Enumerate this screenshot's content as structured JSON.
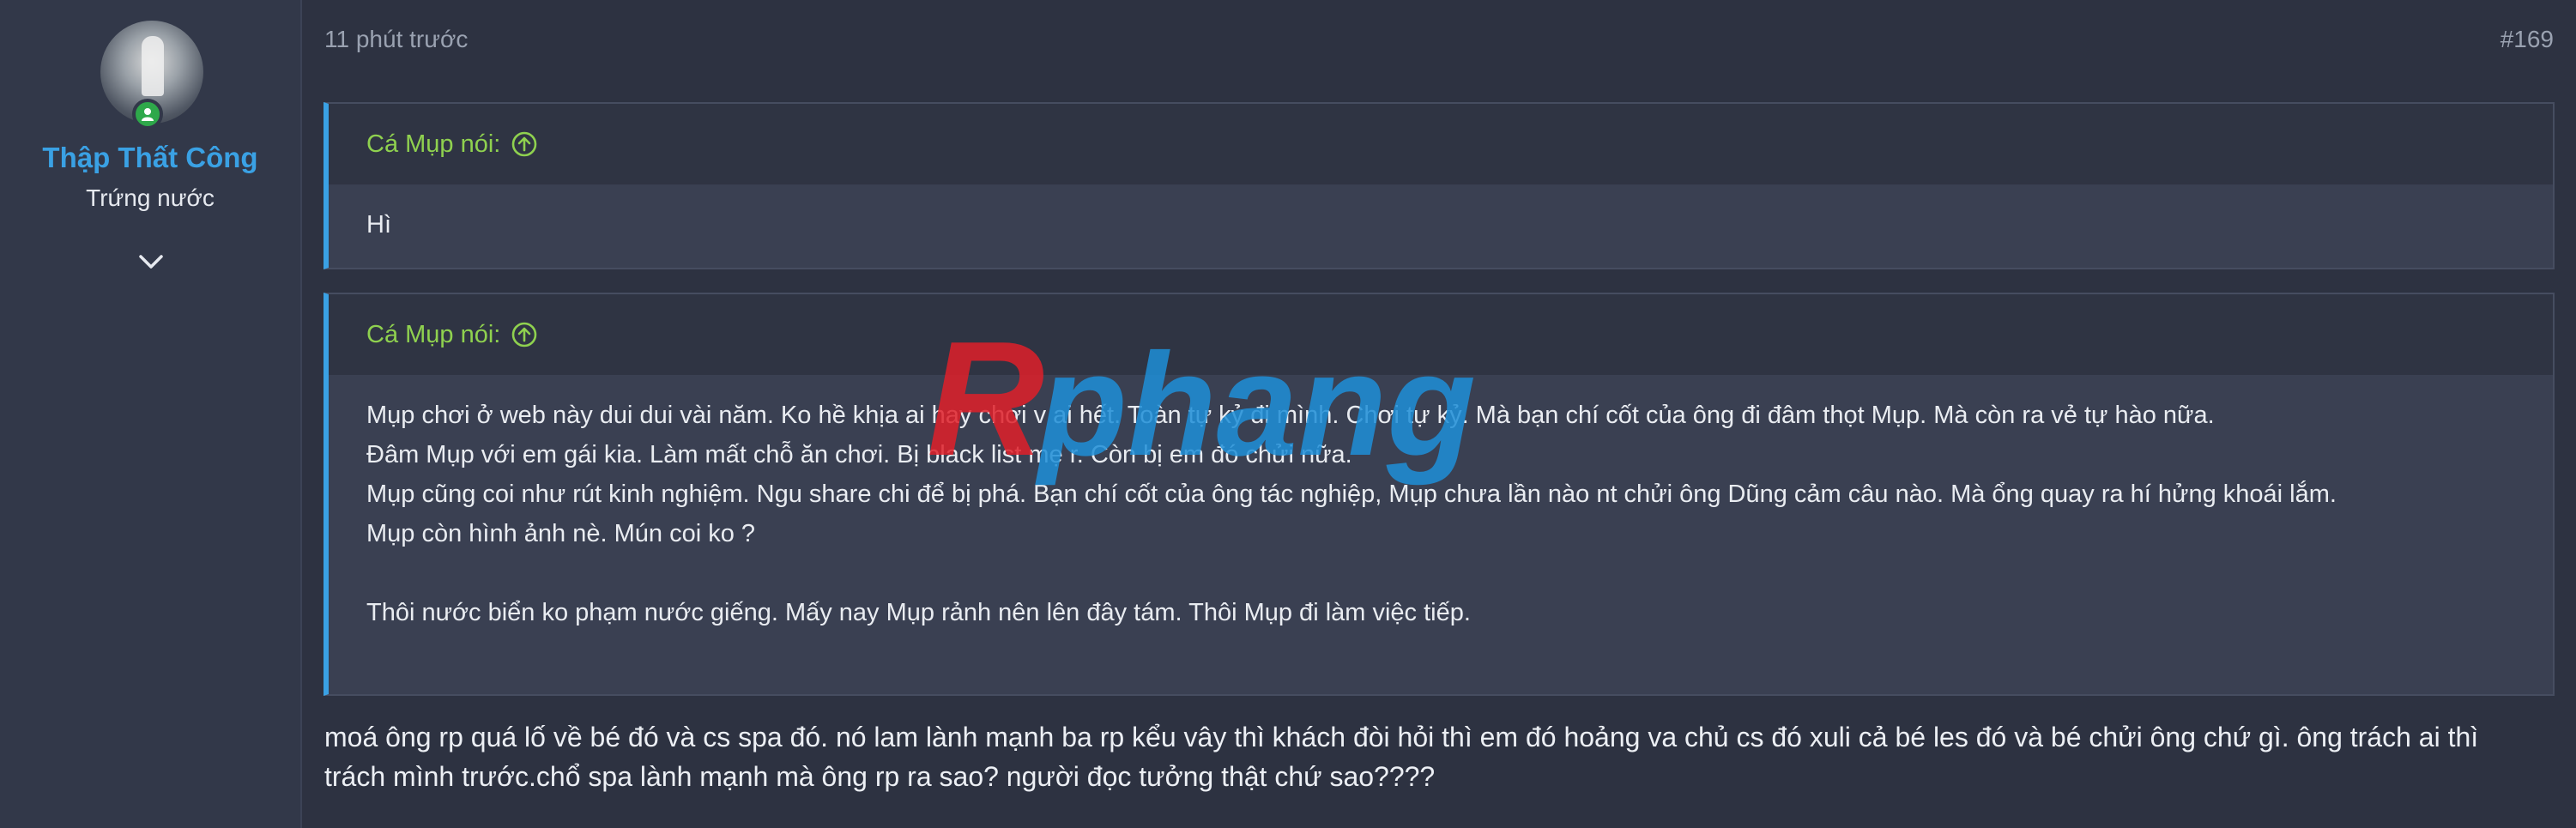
{
  "user": {
    "name": "Thập Thất Công",
    "title": "Trứng nước"
  },
  "post": {
    "time": "11 phút trước",
    "number": "#169"
  },
  "quotes": [
    {
      "author_label": "Cá Mụp nói:",
      "lines": [
        "Hì"
      ]
    },
    {
      "author_label": "Cá Mụp nói:",
      "lines": [
        "Mụp chơi ở web này dui dui vài năm. Ko hề khịa ai hay chơi v ai hết. Toàn tự kỷ đi mình. Chơi tự kỷ. Mà bạn chí cốt của ông đi đâm thọt Mụp. Mà còn ra vẻ tự hào nữa.",
        "Đâm Mụp với em gái kia. Làm mất chỗ ăn chơi. Bị black list mẹ r. Còn bị em đó chửi nữa.",
        "Mụp cũng coi như rút kinh nghiệm. Ngu share chi để bị phá. Bạn chí cốt của ông tác nghiệp, Mụp chưa lần nào nt chửi ông Dũng cảm câu nào. Mà ổng quay ra hí hửng khoái lắm.",
        "Mụp còn hình ảnh nè. Mún coi ko ?",
        "",
        "Thôi nước biển ko phạm nước giếng. Mấy nay Mụp rảnh nên lên đây tám. Thôi Mụp đi làm việc tiếp."
      ]
    }
  ],
  "reply_text": "moá ông rp quá lố về bé đó và cs spa đó. nó lam lành mạnh ba rp kểu vây thì khách đòi hỏi thì em đó hoảng va chủ cs đó xuli cả bé les đó và bé chửi ông chứ gì. ông trách ai thì trách mình trước.chổ spa lành mạnh mà ông rp ra sao? người đọc tưởng thật chứ sao????",
  "watermark": "Rphang",
  "colors": {
    "accent": "#3aa1e4",
    "quote_author": "#8fd14f",
    "online": "#2ea84a",
    "watermark_red": "#e0202a",
    "watermark_blue": "#1e8fd8"
  },
  "icons": {
    "online": "user-online-icon",
    "expand": "chevron-down-icon",
    "quote_jump": "arrow-up-circle-icon"
  }
}
